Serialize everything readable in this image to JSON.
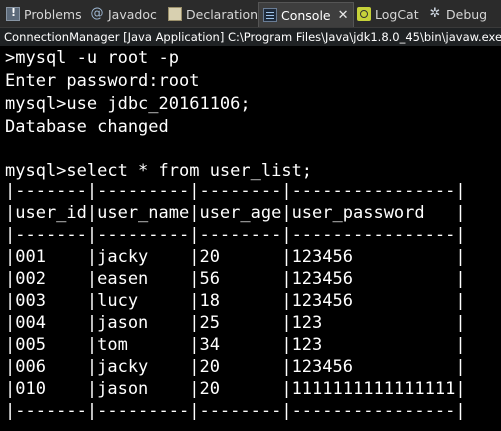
{
  "tabs": [
    {
      "label": "Problems",
      "icon": "problems-icon"
    },
    {
      "label": "Javadoc",
      "icon": "javadoc-icon"
    },
    {
      "label": "Declaration",
      "icon": "declaration-icon"
    },
    {
      "label": "Console",
      "icon": "console-icon",
      "active": true,
      "close": "✕"
    },
    {
      "label": "LogCat",
      "icon": "logcat-icon"
    },
    {
      "label": "Debug",
      "icon": "debug-icon"
    }
  ],
  "status": {
    "text": "ConnectionManager [Java Application] C:\\Program Files\\Java\\jdk1.8.0_45\\bin\\javaw.exe"
  },
  "console": {
    "lines": [
      ">mysql -u root -p",
      "Enter password:root",
      "mysql>use jdbc_20161106;",
      "Database changed",
      "",
      "mysql>select * from user_list;",
      "|-------|---------|--------|----------------|",
      "|user_id|user_name|user_age|user_password   |",
      "|-------|---------|--------|----------------|",
      "|001    |jacky    |20      |123456          |",
      "|002    |easen    |56      |123456          |",
      "|003    |lucy     |18      |123456          |",
      "|004    |jason    |25      |123             |",
      "|005    |tom      |34      |123             |",
      "|006    |jacky    |20      |123456          |",
      "|010    |jason    |20      |1111111111111111|",
      "|-------|---------|--------|----------------|"
    ]
  },
  "colors": {
    "console_bg": "#000000",
    "console_text": "#ffffff",
    "tabbar_bg": "#2b2b2b"
  }
}
